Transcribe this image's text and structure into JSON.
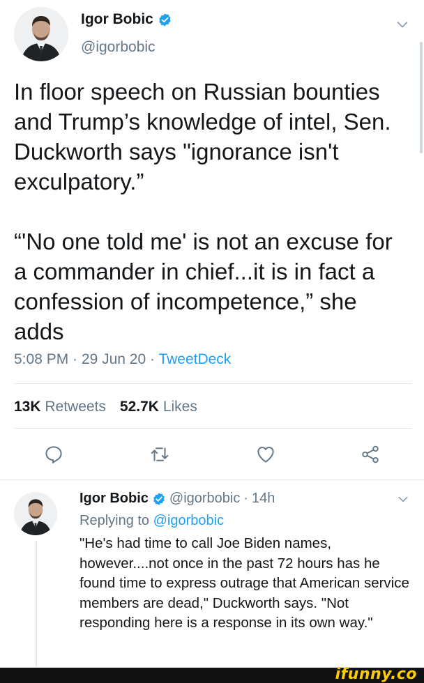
{
  "tweet": {
    "display_name": "Igor Bobic",
    "handle": "@igorbobic",
    "text_paragraphs": [
      "In floor speech on Russian bounties and Trump’s knowledge of intel, Sen. Duckworth says \"ignorance isn't exculpatory.”",
      "“'No one told me' is not an excuse for a commander in chief...it is in fact a confession of incompetence,” she adds"
    ],
    "time": "5:08 PM",
    "date": "29 Jun 20",
    "source": "TweetDeck",
    "meta_sep": " · ",
    "retweets_count": "13K",
    "retweets_label": "Retweets",
    "likes_count": "52.7K",
    "likes_label": "Likes"
  },
  "reply": {
    "display_name": "Igor Bobic",
    "handle": "@igorbobic",
    "time": "14h",
    "sep": "·",
    "replying_prefix": "Replying to",
    "replying_to": "@igorbobic",
    "text": "\"He's had time to call Joe Biden names, however....not once in the past 72 hours has he found time to express outrage that American service members are dead,\" Duckworth says. \"Not responding here is a response in its own way.\""
  },
  "icons": {
    "verified": "verified-badge-icon",
    "chevron": "chevron-down-icon",
    "reply": "reply-icon",
    "retweet": "retweet-icon",
    "like": "heart-icon",
    "share": "share-icon"
  },
  "colors": {
    "accent": "#1da1f2",
    "secondary_text": "#657786",
    "divider": "#e1e8ed",
    "watermark": "#ffcc00"
  },
  "watermark": "ifunny.co"
}
